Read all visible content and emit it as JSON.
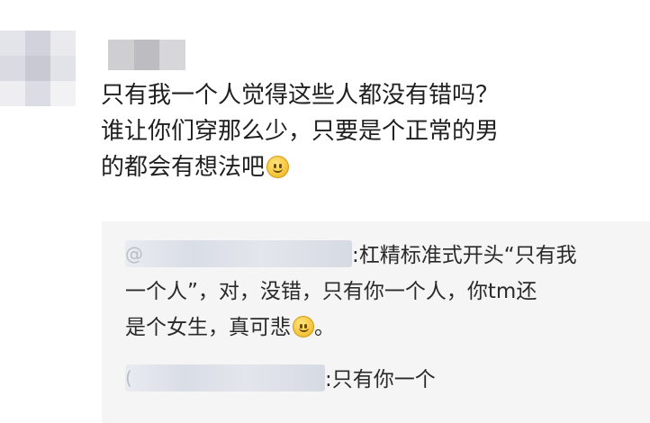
{
  "comment": {
    "lines": [
      "只有我一个人觉得这些人都没有错吗？",
      "谁让你们穿那么少，只要是个正常的男",
      "的都会有想法吧"
    ],
    "trailing_emoji": "smile-emoji"
  },
  "replies": [
    {
      "author_prefix": "@",
      "lines": [
        ":杠精标准式开头“只有我",
        "一个人”，对，没错，只有你一个人，你tm还",
        "是个女生，真可悲"
      ],
      "emoji": "smile-emoji",
      "tail": "。"
    },
    {
      "author_prefix": "(",
      "lines": [
        ":只有你一个"
      ]
    }
  ],
  "colors": {
    "reply_background": "#f5f5f5",
    "text": "#222222"
  }
}
